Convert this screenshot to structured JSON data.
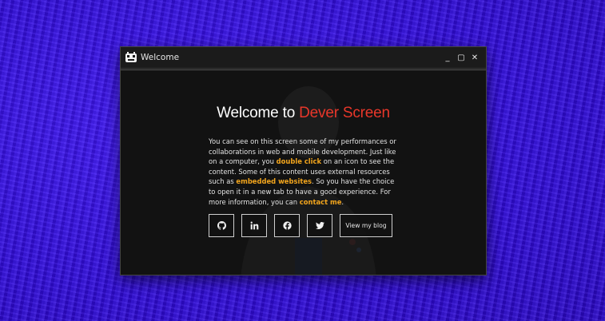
{
  "window": {
    "title": "Welcome",
    "controls": {
      "minimize": "_",
      "maximize": "▢",
      "close": "✕"
    }
  },
  "content": {
    "heading_prefix": "Welcome to ",
    "heading_accent": "Dever Screen",
    "paragraph": [
      {
        "text": "You can see on this screen some of my performances or collaborations in web and mobile development. Just like on a computer, you ",
        "hl": false
      },
      {
        "text": "double click",
        "hl": true
      },
      {
        "text": " on an icon to see the content. Some of this content uses external resources such as ",
        "hl": false
      },
      {
        "text": "embedded websites",
        "hl": true
      },
      {
        "text": ". So you have the choice to open it in a new tab to have a good experience. For more information, you can ",
        "hl": false
      },
      {
        "text": "contact me",
        "hl": true
      },
      {
        "text": ".",
        "hl": false
      }
    ],
    "social_icons": [
      "github-icon",
      "linkedin-icon",
      "facebook-icon",
      "twitter-icon"
    ],
    "blog_button": "View my blog"
  },
  "colors": {
    "accent_red": "#e8372a",
    "highlight_orange": "#f2a51d",
    "window_bg": "#121212",
    "desktop_blue": "#3a14d6"
  }
}
